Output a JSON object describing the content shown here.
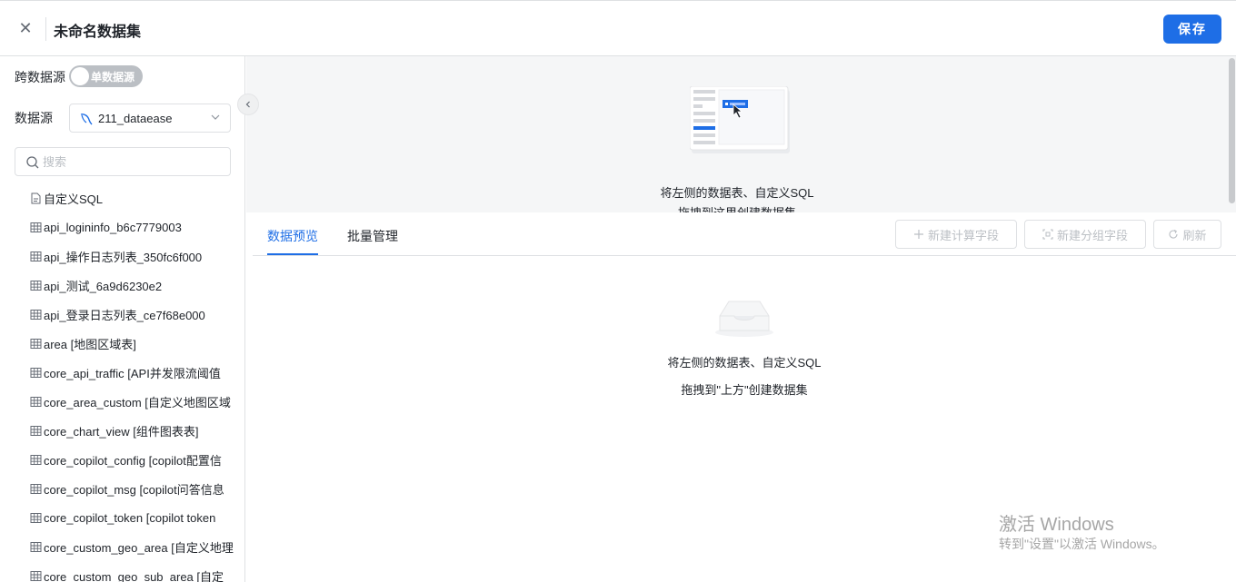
{
  "header": {
    "close_icon": "close-icon",
    "title": "未命名数据集",
    "save_label": "保存"
  },
  "left_panel": {
    "cross_source_label": "跨数据源",
    "cross_source_toggle": {
      "on": false,
      "text": "单数据源"
    },
    "datasource_label": "数据源",
    "datasource_value": "211_dataease",
    "search_placeholder": "搜索",
    "items": [
      {
        "icon": "sql-icon",
        "label": "自定义SQL"
      },
      {
        "icon": "table-icon",
        "label": "api_logininfo_b6c7779003"
      },
      {
        "icon": "table-icon",
        "label": "api_操作日志列表_350fc6f000"
      },
      {
        "icon": "table-icon",
        "label": "api_测试_6a9d6230e2"
      },
      {
        "icon": "table-icon",
        "label": "api_登录日志列表_ce7f68e000"
      },
      {
        "icon": "table-icon",
        "label": "area [地图区域表]"
      },
      {
        "icon": "table-icon",
        "label": "core_api_traffic [API并发限流阈值"
      },
      {
        "icon": "table-icon",
        "label": "core_area_custom [自定义地图区域"
      },
      {
        "icon": "table-icon",
        "label": "core_chart_view [组件图表表]"
      },
      {
        "icon": "table-icon",
        "label": "core_copilot_config [copilot配置信"
      },
      {
        "icon": "table-icon",
        "label": "core_copilot_msg [copilot问答信息"
      },
      {
        "icon": "table-icon",
        "label": "core_copilot_token [copilot token"
      },
      {
        "icon": "table-icon",
        "label": "core_custom_geo_area [自定义地理"
      },
      {
        "icon": "table-icon",
        "label": "core_custom_geo_sub_area [自定"
      }
    ]
  },
  "drop_area": {
    "line1": "将左侧的数据表、自定义SQL",
    "line2": "拖拽到这里创建数据集"
  },
  "bottom_panel": {
    "tabs": [
      {
        "label": "数据预览",
        "active": true
      },
      {
        "label": "批量管理",
        "active": false
      }
    ],
    "buttons": {
      "new_calc_field": "新建计算字段",
      "new_group_field": "新建分组字段",
      "refresh": "刷新"
    },
    "empty_line1": "将左侧的数据表、自定义SQL",
    "empty_line2": "拖拽到\"上方\"创建数据集"
  },
  "watermark": {
    "line1": "激活 Windows",
    "line2": "转到\"设置\"以激活 Windows。"
  },
  "colors": {
    "accent": "#1e6ee6",
    "border": "#dee0e3",
    "drop_bg": "#f5f6f7",
    "disabled_text": "#bbbfc4"
  }
}
